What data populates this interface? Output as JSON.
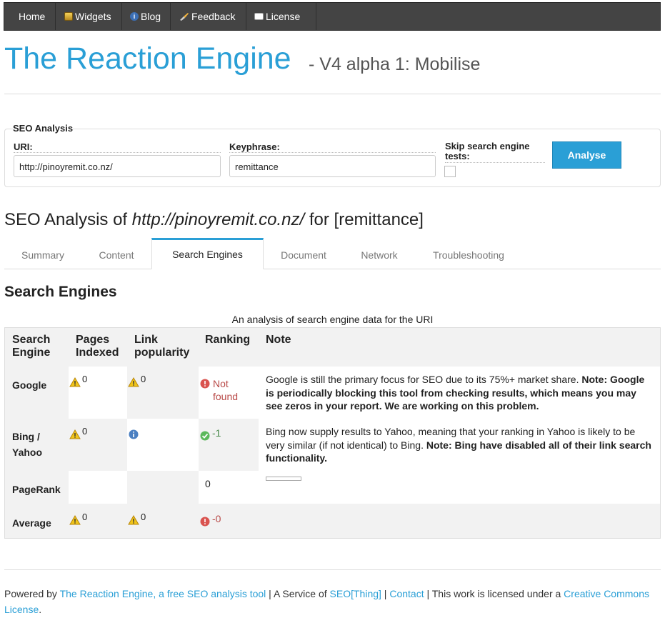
{
  "nav": {
    "items": [
      {
        "label": "Home",
        "icon": ""
      },
      {
        "label": "Widgets",
        "icon": "widgets-icon"
      },
      {
        "label": "Blog",
        "icon": "info-icon"
      },
      {
        "label": "Feedback",
        "icon": "feedback-icon"
      },
      {
        "label": "License",
        "icon": "license-icon"
      }
    ]
  },
  "header": {
    "title": "The Reaction Engine",
    "subtitle": "- V4 alpha 1: Mobilise"
  },
  "form": {
    "legend": "SEO Analysis",
    "uri_label": "URI:",
    "uri_value": "http://pinoyremit.co.nz/",
    "keyphrase_label": "Keyphrase:",
    "keyphrase_value": "remittance",
    "skip_label_line1": "Skip search engine",
    "skip_label_line2": "tests:",
    "skip_checked": false,
    "analyse_button": "Analyse"
  },
  "analysis": {
    "prefix": "SEO Analysis of ",
    "uri": "http://pinoyremit.co.nz/",
    "suffix": " for [remittance]"
  },
  "tabs": [
    {
      "label": "Summary",
      "active": false
    },
    {
      "label": "Content",
      "active": false
    },
    {
      "label": "Search Engines",
      "active": true
    },
    {
      "label": "Document",
      "active": false
    },
    {
      "label": "Network",
      "active": false
    },
    {
      "label": "Troubleshooting",
      "active": false
    }
  ],
  "section": {
    "heading": "Search Engines",
    "caption": "An analysis of search engine data for the URI"
  },
  "table": {
    "headers": {
      "engine": [
        "Search",
        "Engine"
      ],
      "pages": [
        "Pages",
        "Indexed"
      ],
      "link": [
        "Link",
        "popularity"
      ],
      "ranking": "Ranking",
      "note": "Note"
    },
    "rows": {
      "google": {
        "label": "Google",
        "pages": "0",
        "link": "0",
        "ranking_line1": "Not",
        "ranking_line2": "found",
        "note_plain": "Google is still the primary focus for SEO due to its 75%+ market share. ",
        "note_bold": "Note: Google is periodically blocking this tool from checking results, which means you may see zeros in your report. We are working on this problem."
      },
      "bing": {
        "label_line1": "Bing /",
        "label_line2": "Yahoo",
        "pages": "0",
        "ranking": "-1",
        "note_plain": "Bing now supply results to Yahoo, meaning that your ranking in Yahoo is likely to be very similar (if not identical) to Bing. ",
        "note_bold": "Note: Bing have disabled all of their link search functionality."
      },
      "pagerank": {
        "label": "PageRank",
        "ranking": "0",
        "bar_fill": 0
      },
      "average": {
        "label": "Average",
        "pages": "0",
        "link": "0",
        "ranking": "-0"
      }
    }
  },
  "footer": {
    "t1": "Powered by ",
    "l1": "The Reaction Engine, a free SEO analysis tool",
    "t2": " | A Service of ",
    "l2": "SEO[Thing]",
    "t3": " | ",
    "l3": "Contact",
    "t4": " | This work is licensed under a ",
    "l4": "Creative Commons License",
    "t5": "."
  },
  "colors": {
    "accent": "#2a9fd6",
    "navbar": "#444444",
    "warning": "#f0c419",
    "error": "#d9534f",
    "success": "#5cb85c",
    "info": "#4a7fc1"
  }
}
